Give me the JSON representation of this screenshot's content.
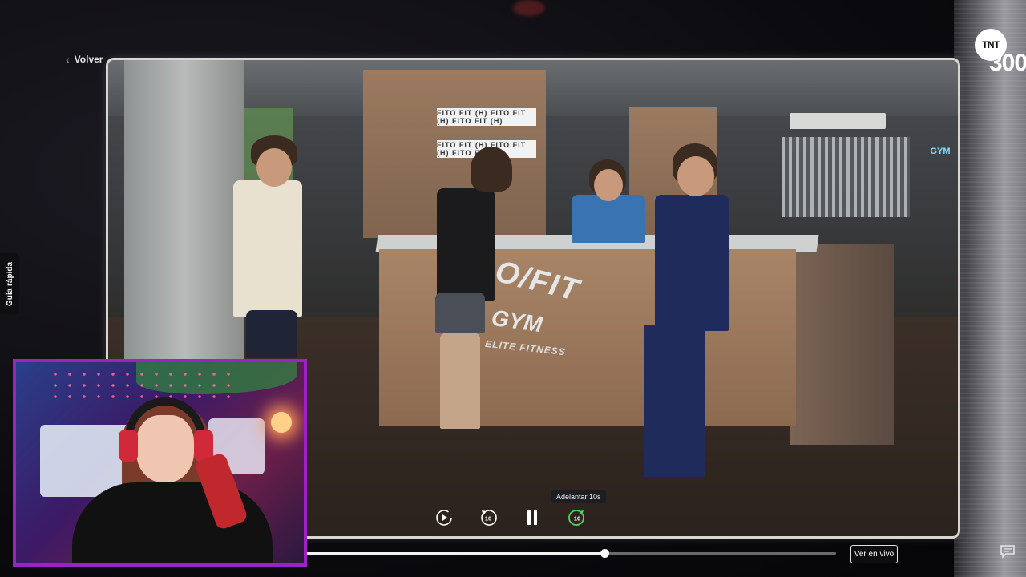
{
  "nav": {
    "back_label": "Volver"
  },
  "channel": {
    "logo_text": "TNT",
    "number_text": "300"
  },
  "side_tab": {
    "label": "Guía rápida"
  },
  "player": {
    "tooltip": "Adelantar 10s",
    "progress": 0.6,
    "live_label": "Ver en vivo",
    "controls": {
      "restart_icon": "restart-icon",
      "rewind_icon": "rewind-10-icon",
      "pause_icon": "pause-icon",
      "forward_icon": "forward-10-icon"
    },
    "skip_seconds": "10"
  },
  "scene": {
    "signs": [
      "FITO FIT (H) FITO FIT (H) FITO FIT (H)",
      "FITO FIT (H) FITO FIT (H) FITO FIT (H)"
    ],
    "logo_main": "O/FIT",
    "logo_gym": "GYM",
    "logo_sub": "ELITE FITNESS",
    "neon": "GYM"
  },
  "colors": {
    "webcam_border": "#a020c8",
    "accent": "#ffffff"
  }
}
